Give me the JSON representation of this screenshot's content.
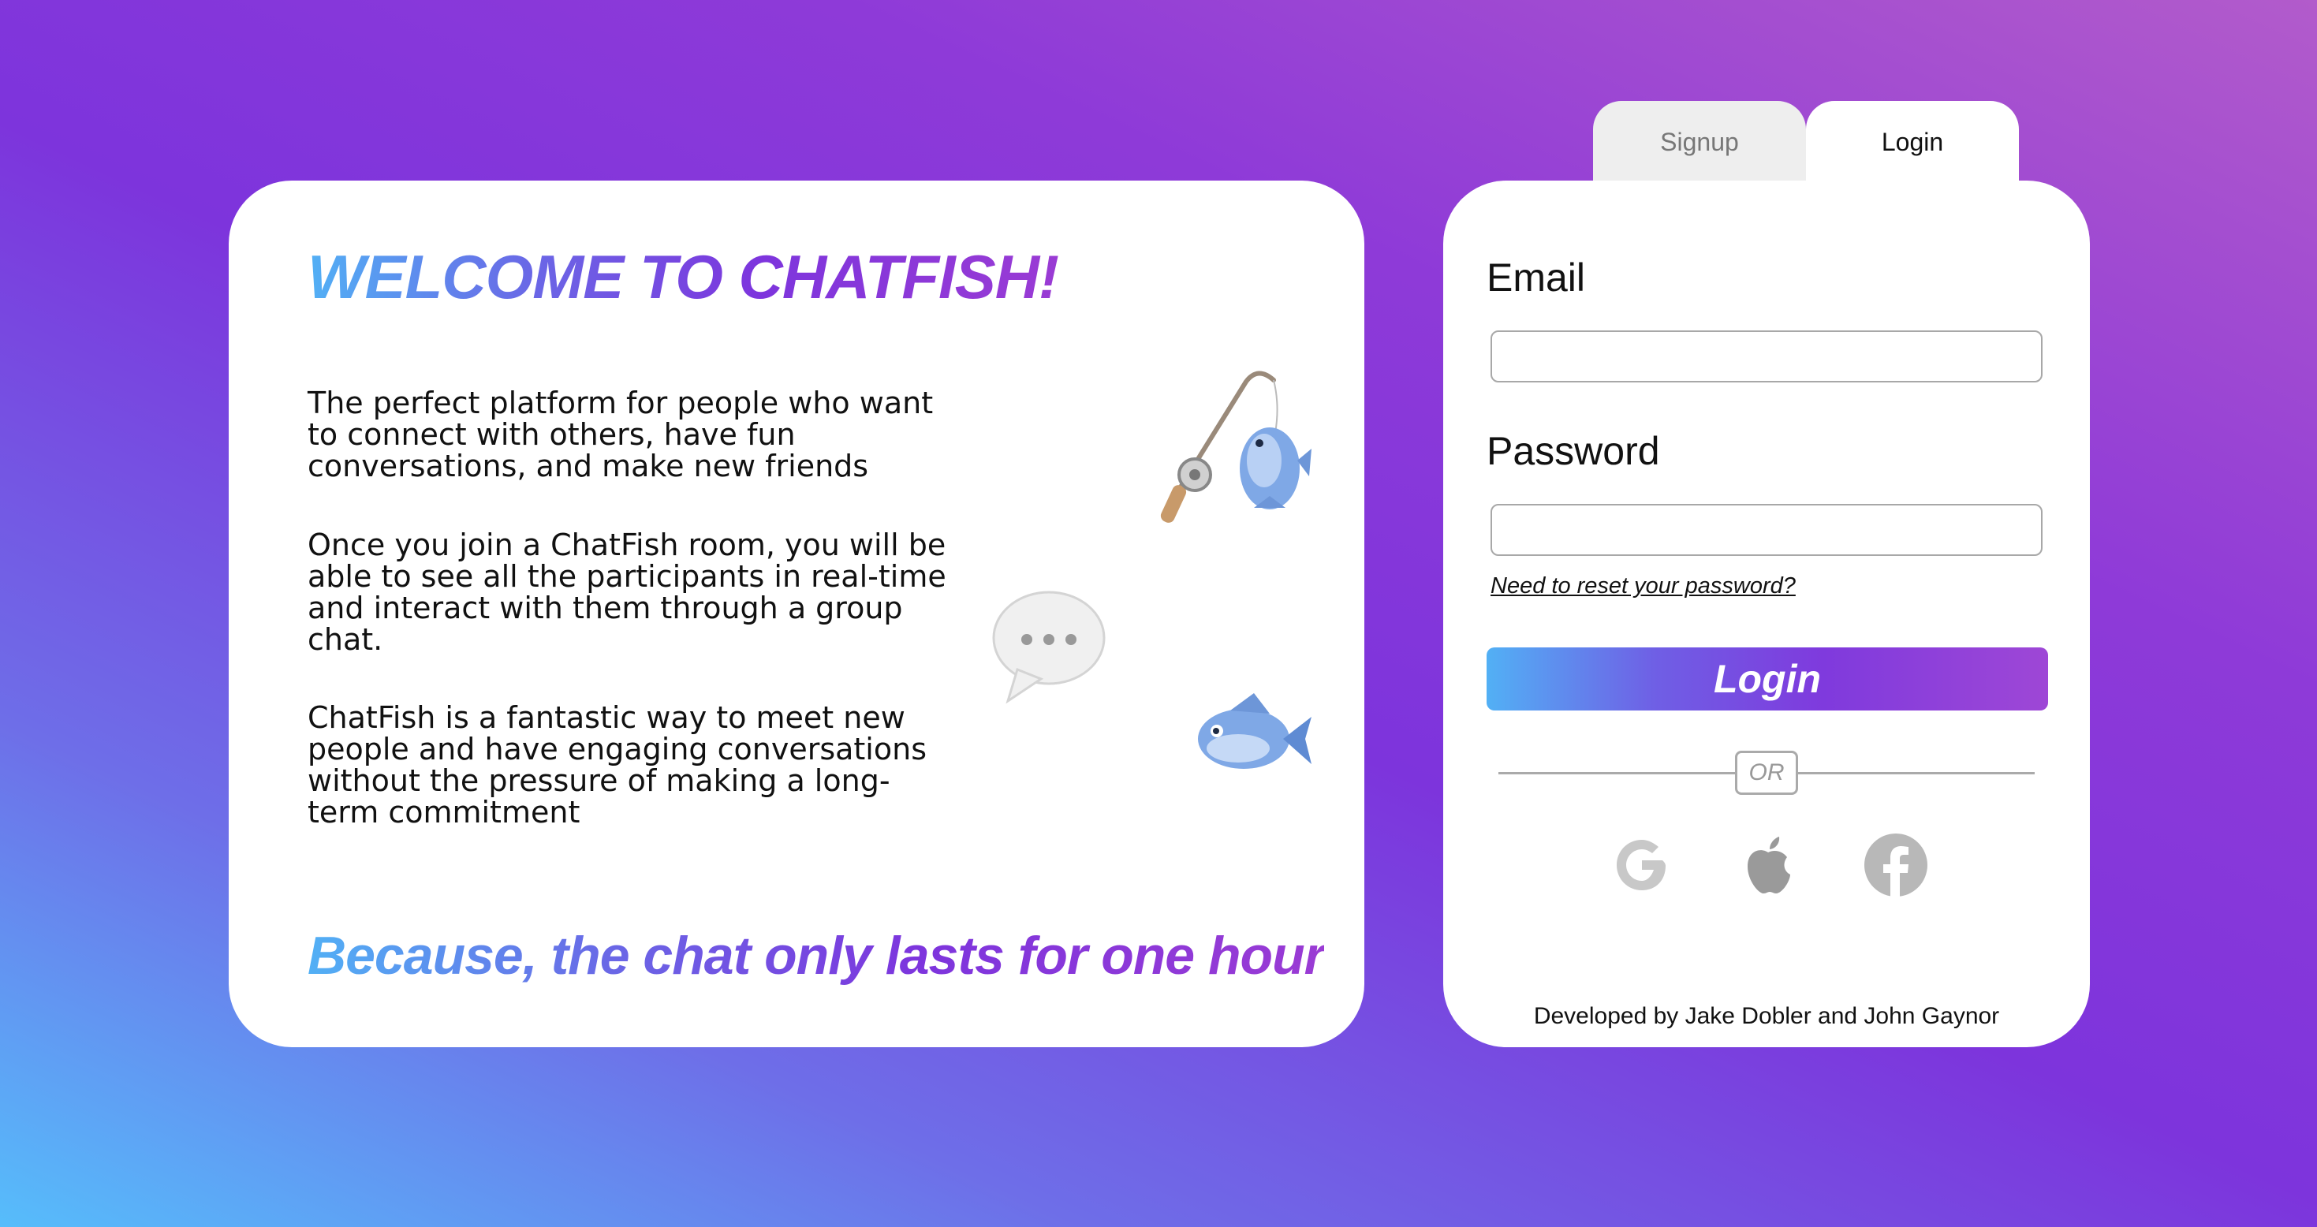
{
  "welcome": {
    "title": "WELCOME TO CHATFISH!",
    "paragraphs": [
      "The perfect platform for people who want to connect with others, have fun conversations, and make new friends",
      "Once you join a ChatFish room, you will be able to see all the participants in real-time and interact with them through a group chat.",
      "ChatFish is a fantastic way to meet new people and have engaging conversations without the pressure of making a long-term commitment"
    ],
    "tagline": "Because, the chat only lasts for one hour",
    "decorations": [
      "fishing-rod-icon",
      "speech-bubble-icon",
      "fish-icon"
    ]
  },
  "tabs": {
    "signup_label": "Signup",
    "login_label": "Login",
    "active": "Login"
  },
  "login_form": {
    "email_label": "Email",
    "email_value": "",
    "password_label": "Password",
    "password_value": "",
    "reset_link": "Need to reset your password?",
    "login_button": "Login",
    "divider_text": "OR",
    "social_providers": [
      "google-icon",
      "apple-icon",
      "facebook-icon"
    ],
    "credits": "Developed by Jake Dobler and John Gaynor"
  },
  "colors": {
    "background_start": "#56bdfb",
    "background_mid": "#7d34dc",
    "background_end": "#b25bcb",
    "gradient_blue": "#52b0f5",
    "gradient_purple": "#7d35dd",
    "social_icon_gray": "#9e9e9e"
  }
}
